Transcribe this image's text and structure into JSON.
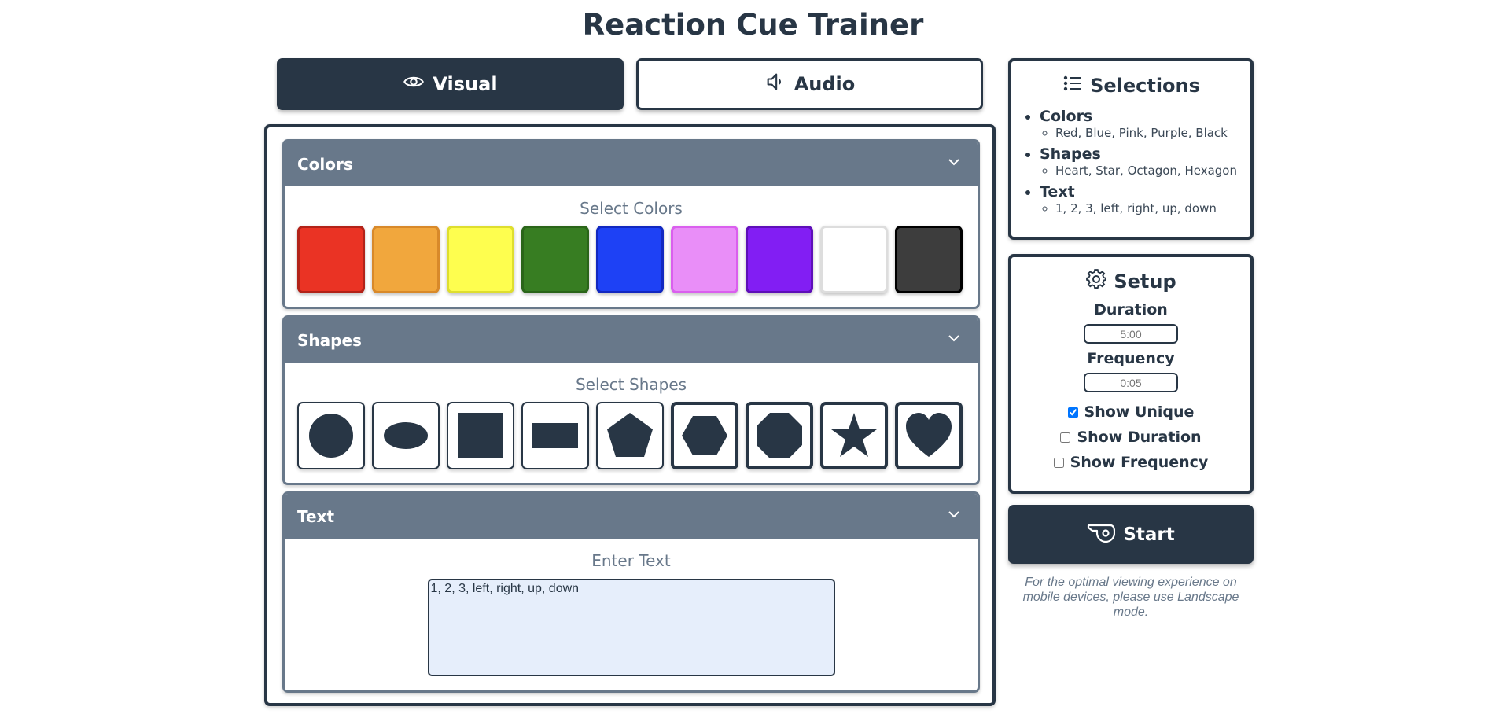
{
  "app": {
    "title": "Reaction Cue Trainer"
  },
  "tabs": [
    {
      "label": "Visual",
      "icon": "eye-icon",
      "active": true
    },
    {
      "label": "Audio",
      "icon": "speaker-icon",
      "active": false
    }
  ],
  "sections": {
    "colors": {
      "heading": "Colors",
      "subtitle": "Select Colors",
      "swatches": [
        {
          "fill": "#ea3324",
          "border": "#b22218"
        },
        {
          "fill": "#f1a73d",
          "border": "#d8892a"
        },
        {
          "fill": "#fefe4f",
          "border": "#dede2f"
        },
        {
          "fill": "#377d22",
          "border": "#2a6519"
        },
        {
          "fill": "#1e41f5",
          "border": "#1228c0"
        },
        {
          "fill": "#e98ef8",
          "border": "#da5fee"
        },
        {
          "fill": "#821ef3",
          "border": "#5e0fb8"
        },
        {
          "fill": "#ffffff",
          "border": "#dddddd"
        },
        {
          "fill": "#3d3d3d",
          "border": "#000000"
        }
      ]
    },
    "shapes": {
      "heading": "Shapes",
      "subtitle": "Select Shapes",
      "items": [
        {
          "icon": "circle-icon",
          "selected": false
        },
        {
          "icon": "ellipse-icon",
          "selected": false
        },
        {
          "icon": "square-icon",
          "selected": false
        },
        {
          "icon": "rectangle-icon",
          "selected": false
        },
        {
          "icon": "pentagon-icon",
          "selected": false
        },
        {
          "icon": "hexagon-icon",
          "selected": true
        },
        {
          "icon": "octagon-icon",
          "selected": true
        },
        {
          "icon": "star-icon",
          "selected": true
        },
        {
          "icon": "heart-icon",
          "selected": true
        }
      ]
    },
    "text": {
      "heading": "Text",
      "subtitle": "Enter Text",
      "value": "1, 2, 3, left, right, up, down"
    }
  },
  "selections": {
    "title": "Selections",
    "groups": [
      {
        "label": "Colors",
        "values": "Red, Blue, Pink, Purple, Black"
      },
      {
        "label": "Shapes",
        "values": "Heart, Star, Octagon, Hexagon"
      },
      {
        "label": "Text",
        "values": "1, 2, 3, left, right, up, down"
      }
    ]
  },
  "setup": {
    "title": "Setup",
    "duration_label": "Duration",
    "duration_placeholder": "5:00",
    "frequency_label": "Frequency",
    "frequency_placeholder": "0:05",
    "options": [
      {
        "label": "Show Unique",
        "checked": true
      },
      {
        "label": "Show Duration",
        "checked": false
      },
      {
        "label": "Show Frequency",
        "checked": false
      }
    ]
  },
  "start": {
    "label": "Start",
    "icon": "whistle-icon"
  },
  "notice": "For the optimal viewing experience on mobile devices, please use Landscape mode."
}
